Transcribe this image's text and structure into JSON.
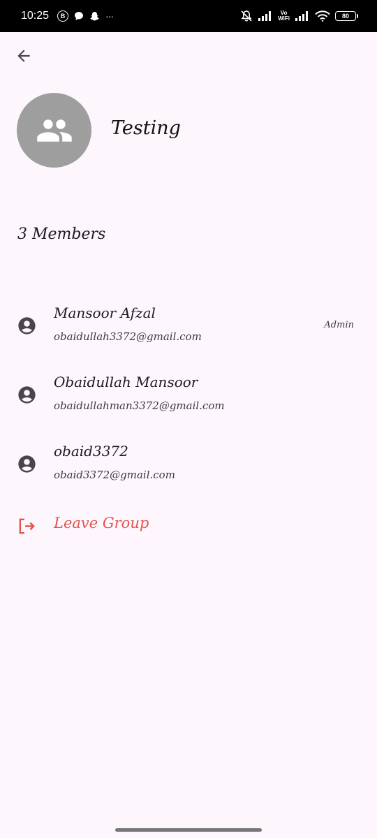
{
  "status_bar": {
    "time": "10:25",
    "b_badge": "B",
    "more": "···",
    "vowifi_top": "Vo",
    "vowifi_bottom": "WiFi",
    "battery": "80"
  },
  "group": {
    "name": "Testing",
    "members_label": "3 Members"
  },
  "members": [
    {
      "name": "Mansoor Afzal",
      "email": "obaidullah3372@gmail.com",
      "role": "Admin"
    },
    {
      "name": "Obaidullah Mansoor",
      "email": "obaidullahman3372@gmail.com",
      "role": ""
    },
    {
      "name": "obaid3372",
      "email": "obaid3372@gmail.com",
      "role": ""
    }
  ],
  "actions": {
    "leave_label": "Leave Group"
  },
  "colors": {
    "background": "#fdf7fd",
    "avatar_bg": "#9e9e9e",
    "leave": "#e5534b"
  },
  "icons": {
    "back": "arrow-back-icon",
    "group": "group-icon",
    "member": "account-circle-icon",
    "leave": "logout-icon"
  }
}
